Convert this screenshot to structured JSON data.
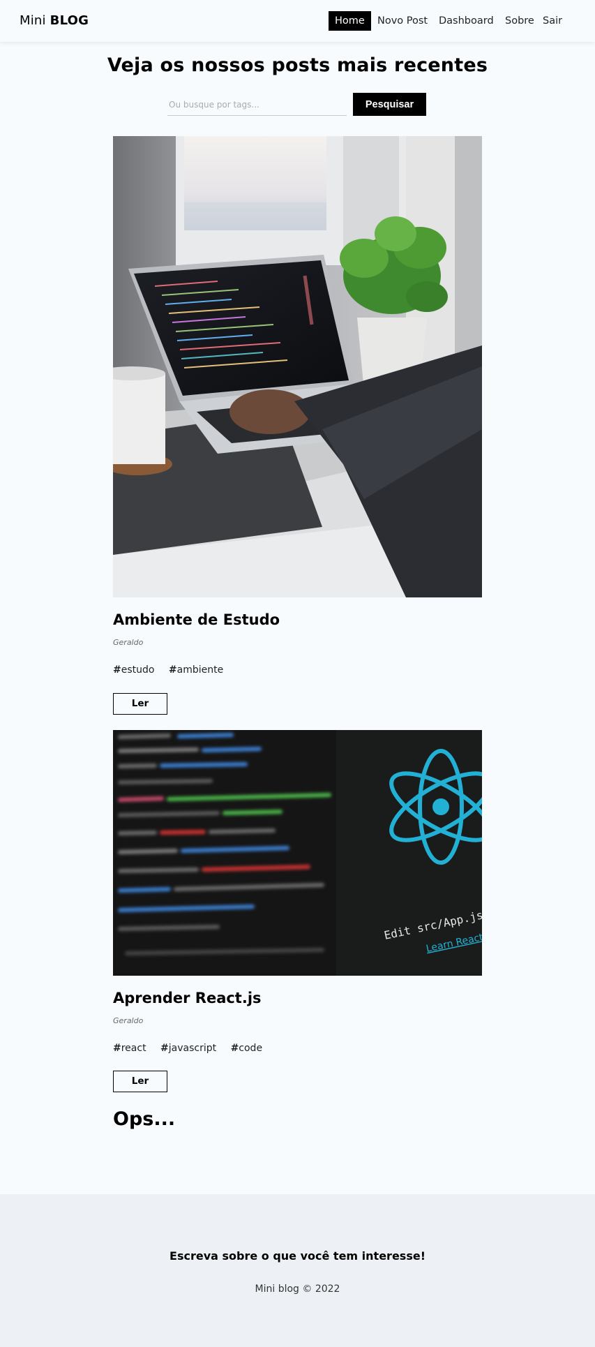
{
  "navbar": {
    "brand_light": "Mini",
    "brand_bold": "BLOG",
    "links": [
      {
        "label": "Home",
        "active": true
      },
      {
        "label": "Novo Post",
        "active": false
      },
      {
        "label": "Dashboard",
        "active": false
      },
      {
        "label": "Sobre",
        "active": false
      }
    ],
    "logout_label": "Sair"
  },
  "header": {
    "title": "Veja os nossos posts mais recentes"
  },
  "search": {
    "placeholder": "Ou busque por tags...",
    "value": "",
    "button_label": "Pesquisar"
  },
  "posts": [
    {
      "image_icon": "laptop-photo",
      "title": "Ambiente de Estudo",
      "author": "Geraldo",
      "tags": [
        "estudo",
        "ambiente"
      ],
      "read_label": "Ler"
    },
    {
      "image_icon": "react-code-photo",
      "title": "Aprender React.js",
      "author": "Geraldo",
      "tags": [
        "react",
        "javascript",
        "code"
      ],
      "read_label": "Ler",
      "image_text_line1": "Edit src/App.js and save to",
      "image_text_line2": "Learn React"
    }
  ],
  "empty_message": "Ops...",
  "footer": {
    "headline": "Escreva sobre o que você tem interesse!",
    "copyright": "Mini blog © 2022"
  },
  "colors": {
    "page_bg": "#f8fbfe",
    "footer_bg": "#edf1f5",
    "accent": "#000000",
    "react_blue": "#22b0d4"
  }
}
